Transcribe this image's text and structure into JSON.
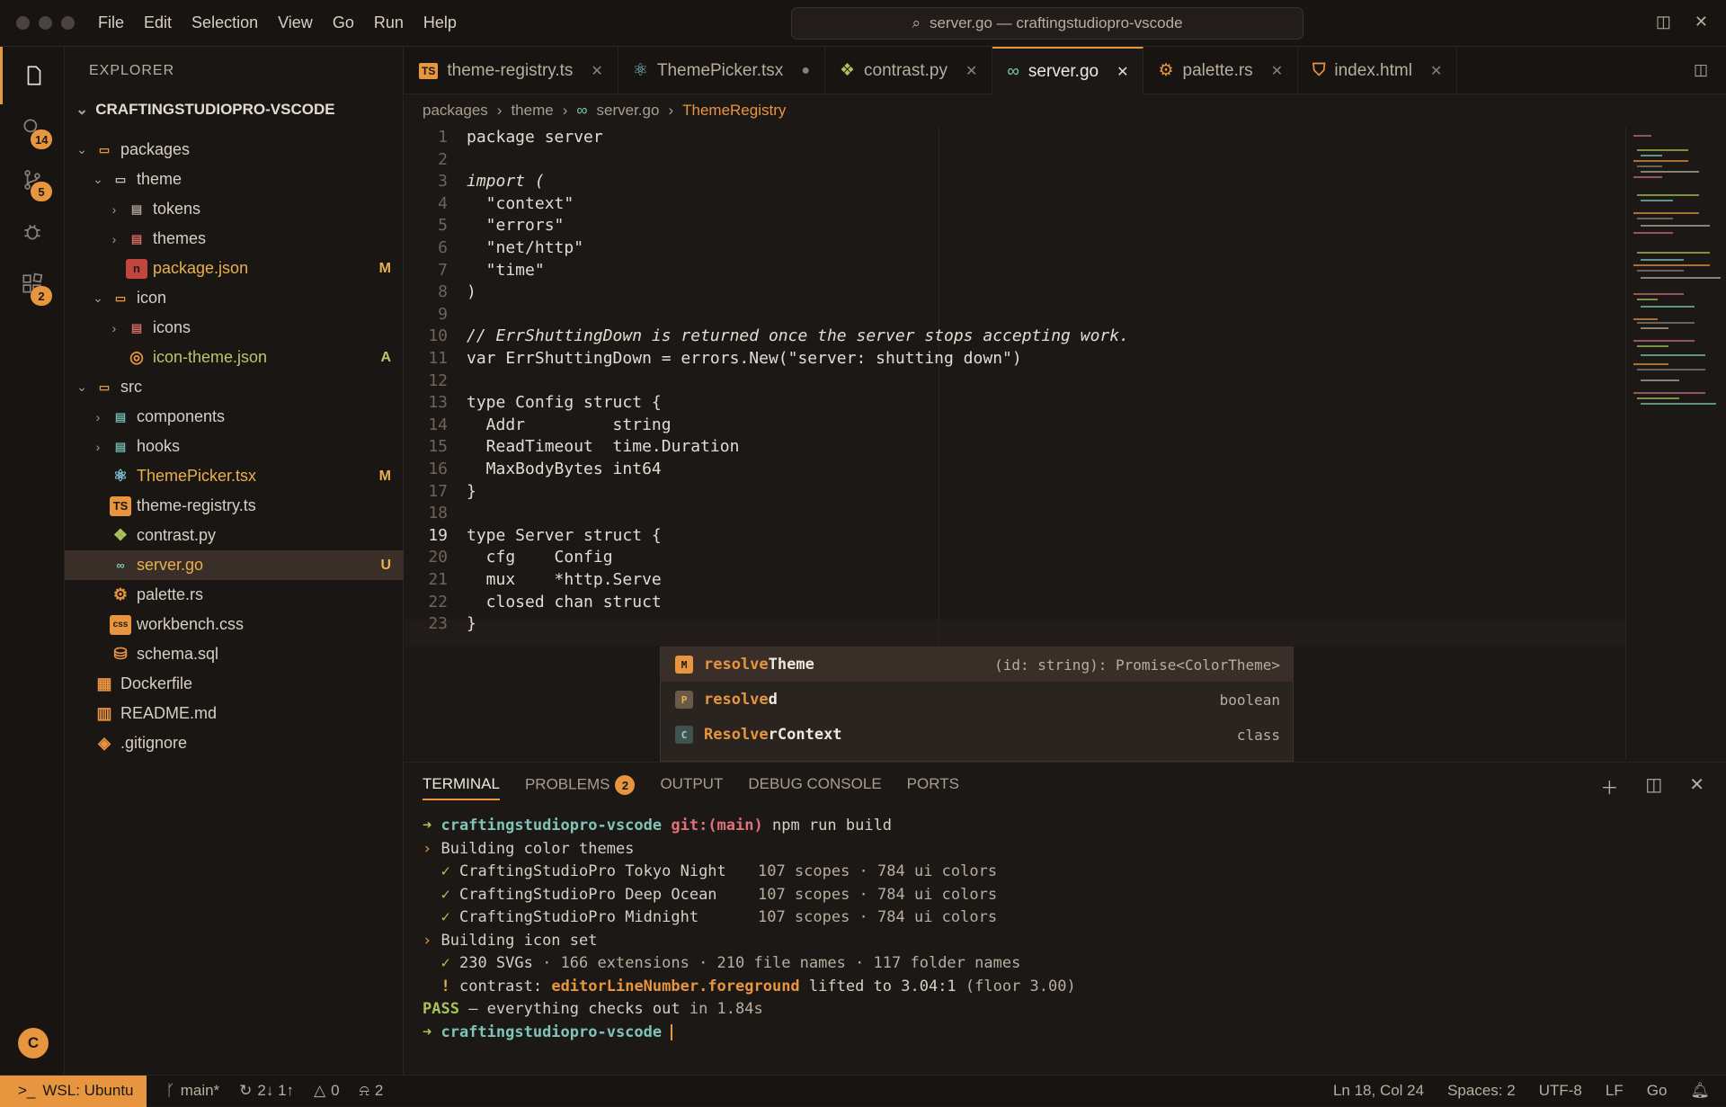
{
  "titlebar": {
    "menu": [
      "File",
      "Edit",
      "Selection",
      "View",
      "Go",
      "Run",
      "Help"
    ],
    "command_center": "server.go — craftingstudiopro-vscode"
  },
  "activity": {
    "search_badge": "14",
    "scm_badge": "5",
    "ext_badge": "2",
    "avatar": "C"
  },
  "sidebar": {
    "title": "EXPLORER",
    "root": "CRAFTINGSTUDIOPRO-VSCODE",
    "items": [
      {
        "label": "packages",
        "status": ""
      },
      {
        "label": "theme",
        "status": ""
      },
      {
        "label": "tokens",
        "status": ""
      },
      {
        "label": "themes",
        "status": ""
      },
      {
        "label": "package.json",
        "status": "M"
      },
      {
        "label": "icon",
        "status": ""
      },
      {
        "label": "icons",
        "status": ""
      },
      {
        "label": "icon-theme.json",
        "status": "A"
      },
      {
        "label": "src",
        "status": ""
      },
      {
        "label": "components",
        "status": ""
      },
      {
        "label": "hooks",
        "status": ""
      },
      {
        "label": "ThemePicker.tsx",
        "status": "M"
      },
      {
        "label": "theme-registry.ts",
        "status": ""
      },
      {
        "label": "contrast.py",
        "status": ""
      },
      {
        "label": "server.go",
        "status": "U"
      },
      {
        "label": "palette.rs",
        "status": ""
      },
      {
        "label": "workbench.css",
        "status": ""
      },
      {
        "label": "schema.sql",
        "status": ""
      },
      {
        "label": "Dockerfile",
        "status": ""
      },
      {
        "label": "README.md",
        "status": ""
      },
      {
        "label": ".gitignore",
        "status": ""
      }
    ]
  },
  "tabs": [
    {
      "label": "theme-registry.ts"
    },
    {
      "label": "ThemePicker.tsx"
    },
    {
      "label": "contrast.py"
    },
    {
      "label": "server.go"
    },
    {
      "label": "palette.rs"
    },
    {
      "label": "index.html"
    }
  ],
  "breadcrumb": [
    "packages",
    "theme",
    "server.go",
    "ThemeRegistry"
  ],
  "editor": {
    "current_line": "19",
    "lines": [
      "package server",
      "",
      "import (",
      "  \"context\"",
      "  \"errors\"",
      "  \"net/http\"",
      "  \"time\"",
      ")",
      "",
      "// ErrShuttingDown is returned once the server stops accepting work.",
      "var ErrShuttingDown = errors.New(\"server: shutting down\")",
      "",
      "type Config struct {",
      "  Addr         string",
      "  ReadTimeout  time.Duration",
      "  MaxBodyBytes int64",
      "}",
      "",
      "type Server struct {",
      "  cfg    Config",
      "  mux    *http.Serve",
      "  closed chan struct",
      "}"
    ]
  },
  "suggest": [
    {
      "kind": "M",
      "match": "resolve",
      "rest": "Theme",
      "detail": "(id: string): Promise<ColorTheme>"
    },
    {
      "kind": "P",
      "match": "resolve",
      "rest": "d",
      "detail": "boolean"
    },
    {
      "kind": "C",
      "match": "Resolve",
      "rest": "rContext",
      "detail": "class"
    }
  ],
  "panel": {
    "tabs": [
      "TERMINAL",
      "PROBLEMS",
      "OUTPUT",
      "DEBUG CONSOLE",
      "PORTS"
    ],
    "problems_count": "2",
    "terminal": {
      "repo": "craftingstudiopro-vscode",
      "git_branch": "git:(main)",
      "command": "npm run build",
      "l2": "Building color themes",
      "t1": "CraftingStudioPro Tokyo Night",
      "t2": "CraftingStudioPro Deep Ocean",
      "t3": "CraftingStudioPro Midnight",
      "tstat": "107 scopes · 784 ui colors",
      "l6": "Building icon set",
      "svgs": "230 SVGs",
      "svgs_rest": " · 166 extensions · 210 file names · 117 folder names",
      "warn_pre": "contrast: ",
      "warn_key": "editorLineNumber.foreground",
      "warn_mid": " lifted to 3.04:1",
      "warn_post": " (floor 3.00)",
      "pass": "PASS",
      "pass_msg": " – everything checks out",
      "pass_time": " in 1.84s"
    }
  },
  "status": {
    "remote": "WSL: Ubuntu",
    "branch": "main*",
    "sync": "2↓ 1↑",
    "errors": "0",
    "warnings": "2",
    "position": "Ln 18, Col 24",
    "spaces": "Spaces: 2",
    "encoding": "UTF-8",
    "eol": "LF",
    "language": "Go"
  },
  "colors": {
    "accent": "#e8953f",
    "keyword": "#e4dcd2",
    "string": "#e4dcd2"
  }
}
